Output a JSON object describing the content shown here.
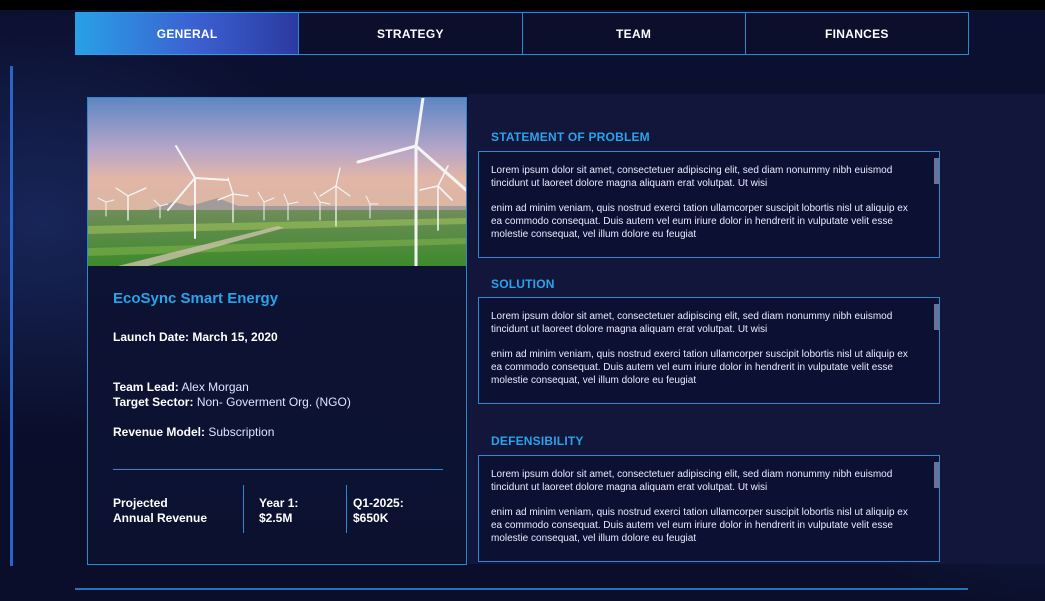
{
  "tabs": [
    {
      "label": "GENERAL",
      "active": true
    },
    {
      "label": "STRATEGY",
      "active": false
    },
    {
      "label": "TEAM",
      "active": false
    },
    {
      "label": "FINANCES",
      "active": false
    }
  ],
  "card": {
    "company": "EcoSync Smart Energy",
    "launch_date": "Launch Date: March 15, 2020",
    "team_lead_label": "Team Lead:",
    "team_lead_value": "Alex Morgan",
    "sector_label": "Target Sector:",
    "sector_value": "Non- Goverment Org. (NGO)",
    "revenue_model_label": "Revenue Model:",
    "revenue_model_value": "Subscription",
    "metrics": {
      "projected_line1": "Projected",
      "projected_line2": "Annual Revenue",
      "year1_label": "Year 1:",
      "year1_value": "$2.5M",
      "q1_label": "Q1-2025:",
      "q1_value": "$650K"
    }
  },
  "sections": [
    {
      "title": "STATEMENT OF PROBLEM",
      "p1": "Lorem ipsum dolor sit amet, consectetuer adipiscing elit, sed diam nonummy nibh euismod tincidunt ut laoreet dolore magna aliquam erat volutpat. Ut wisi",
      "p2": "enim ad minim veniam, quis nostrud exerci tation ullamcorper suscipit lobortis nisl ut aliquip ex ea commodo consequat. Duis autem vel eum iriure dolor in hendrerit in vulputate velit esse molestie consequat, vel illum dolore eu feugiat"
    },
    {
      "title": "SOLUTION",
      "p1": "Lorem ipsum dolor sit amet, consectetuer adipiscing elit, sed diam nonummy nibh euismod tincidunt ut laoreet dolore magna aliquam erat volutpat. Ut wisi",
      "p2": "enim ad minim veniam, quis nostrud exerci tation ullamcorper suscipit lobortis nisl ut aliquip ex ea commodo consequat. Duis autem vel eum iriure dolor in hendrerit in vulputate velit esse molestie consequat, vel illum dolore eu feugiat"
    },
    {
      "title": "DEFENSIBILITY",
      "p1": "Lorem ipsum dolor sit amet, consectetuer adipiscing elit, sed diam nonummy nibh euismod tincidunt ut laoreet dolore magna aliquam erat volutpat. Ut wisi",
      "p2": "enim ad minim veniam, quis nostrud exerci tation ullamcorper suscipit lobortis nisl ut aliquip ex ea commodo consequat. Duis autem vel eum iriure dolor in hendrerit in vulputate velit esse molestie consequat, vel illum dolore eu feugiat"
    }
  ],
  "colors": {
    "accent": "#2aa3ea",
    "border": "#2a8ad0",
    "background": "#0b0f2c"
  }
}
